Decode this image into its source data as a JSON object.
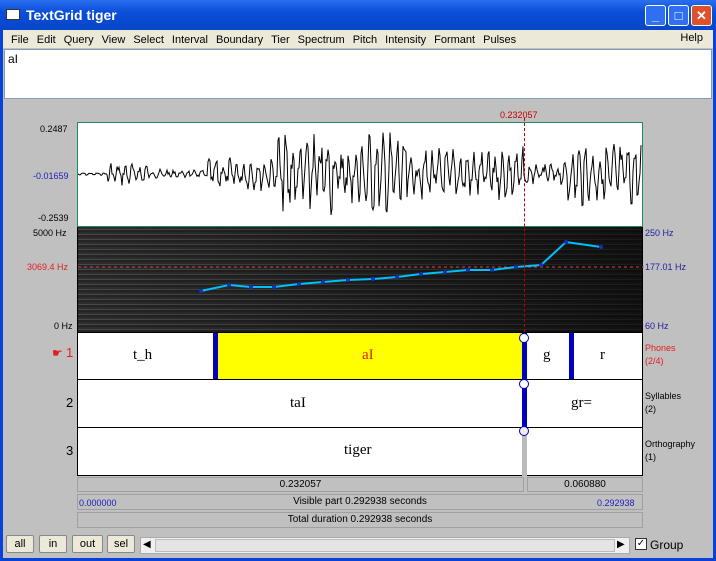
{
  "window": {
    "title": "TextGrid tiger",
    "minimize": "_",
    "maximize": "□",
    "close": "✕"
  },
  "menu": [
    "File",
    "Edit",
    "Query",
    "View",
    "Select",
    "Interval",
    "Boundary",
    "Tier",
    "Spectrum",
    "Pitch",
    "Intensity",
    "Formant",
    "Pulses"
  ],
  "help": "Help",
  "text_field": "aI",
  "cursor_time": "0.232057",
  "waveform": {
    "max": "0.2487",
    "cursor_value": "-0.01659",
    "min": "-0.2539"
  },
  "spectrogram": {
    "top": "5000 Hz",
    "cursor_freq": "3069.4 Hz",
    "bottom": "0 Hz"
  },
  "pitch": {
    "top": "250 Hz",
    "cursor_value": "177.01 Hz",
    "bottom": "60 Hz",
    "color": "#00c0ff"
  },
  "tiers": [
    {
      "number": "1",
      "name": "Phones",
      "count": "(2/4)",
      "intervals": [
        "t_h",
        "aI",
        "g",
        "r"
      ],
      "selected": "aI"
    },
    {
      "number": "2",
      "name": "Syllables",
      "count": "(2)",
      "intervals": [
        "taI",
        "gr="
      ]
    },
    {
      "number": "3",
      "name": "Orthography",
      "count": "(1)",
      "intervals": [
        "tiger"
      ]
    }
  ],
  "timebar": {
    "left": "0.232057",
    "right": "0.060880",
    "start": "0.000000",
    "end": "0.292938",
    "visible": "Visible part 0.292938 seconds",
    "total": "Total duration 0.292938 seconds"
  },
  "buttons": {
    "all": "all",
    "in": "in",
    "out": "out",
    "sel": "sel"
  },
  "group": {
    "label": "Group",
    "checked": true
  },
  "colors": {
    "selection": "#ffff00",
    "boundary": "#0000c0",
    "cursor": "#c00000"
  }
}
